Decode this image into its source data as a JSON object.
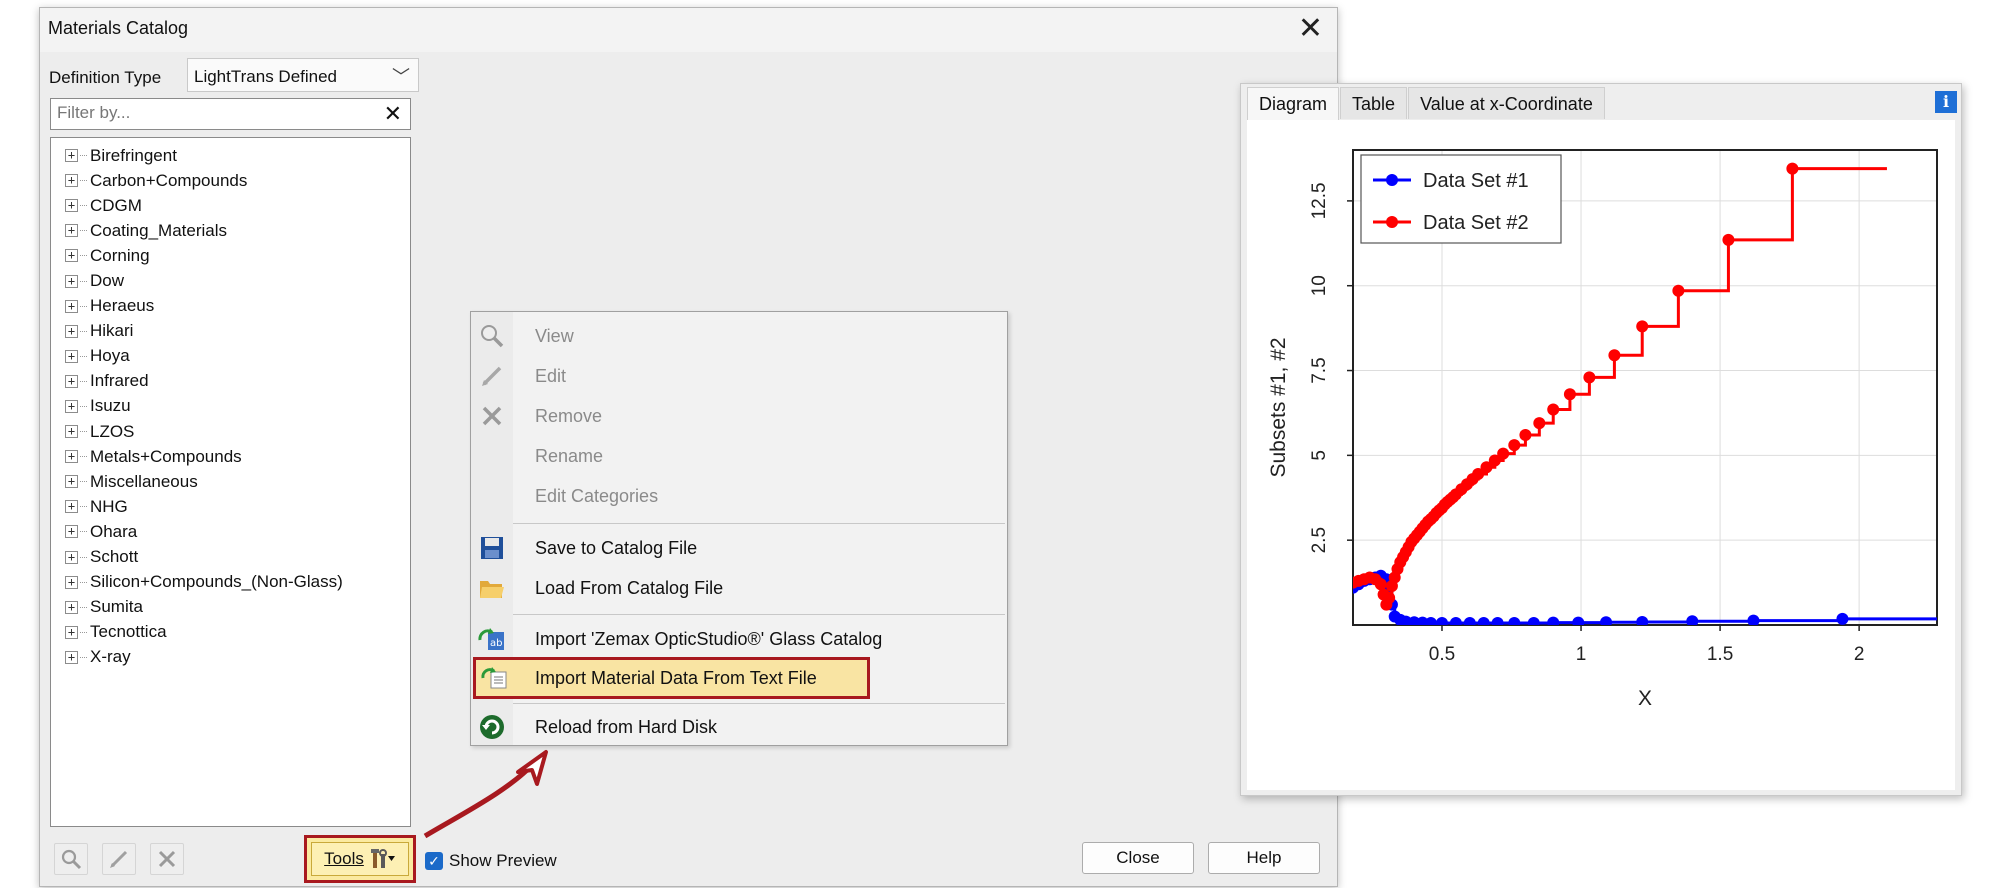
{
  "dialog": {
    "title": "Materials Catalog",
    "definition_type_label": "Definition Type",
    "definition_type_value": "LightTrans Defined",
    "filter_placeholder": "Filter by...",
    "tree_items": [
      "Birefringent",
      "Carbon+Compounds",
      "CDGM",
      "Coating_Materials",
      "Corning",
      "Dow",
      "Heraeus",
      "Hikari",
      "Hoya",
      "Infrared",
      "Isuzu",
      "LZOS",
      "Metals+Compounds",
      "Miscellaneous",
      "NHG",
      "Ohara",
      "Schott",
      "Silicon+Compounds_(Non-Glass)",
      "Sumita",
      "Tecnottica",
      "X-ray"
    ],
    "tools_label": "Tools",
    "show_preview_label": "Show Preview",
    "close_label": "Close",
    "help_label": "Help"
  },
  "menu": {
    "items": [
      {
        "label": "View",
        "icon": "magnifier-icon",
        "enabled": false
      },
      {
        "label": "Edit",
        "icon": "pencil-icon",
        "enabled": false
      },
      {
        "label": "Remove",
        "icon": "x-icon",
        "enabled": false
      },
      {
        "label": "Rename",
        "icon": "",
        "enabled": false
      },
      {
        "label": "Edit Categories",
        "icon": "",
        "enabled": false
      },
      {
        "label": "Save to Catalog File",
        "icon": "floppy-icon",
        "enabled": true
      },
      {
        "label": "Load From Catalog File",
        "icon": "folder-icon",
        "enabled": true
      },
      {
        "label": "Import 'Zemax OpticStudio®' Glass Catalog",
        "icon": "import-glass-icon",
        "enabled": true
      },
      {
        "label": "Import Material Data From Text File",
        "icon": "import-text-icon",
        "enabled": true
      },
      {
        "label": "Reload from Hard Disk",
        "icon": "reload-icon",
        "enabled": true
      }
    ]
  },
  "diagram": {
    "tabs": [
      "Diagram",
      "Table",
      "Value at x-Coordinate"
    ],
    "active_tab": "Diagram"
  },
  "colors": {
    "highlight_border": "#a8191f",
    "highlight_fill": "#f9e4a3",
    "series1": "#0000ff",
    "series2": "#ff0000"
  },
  "chart_data": {
    "type": "line",
    "xlabel": "X",
    "ylabel": "Subsets #1, #2",
    "xlim": [
      0.18,
      2.28
    ],
    "ylim": [
      0,
      14
    ],
    "xticks": [
      0.5,
      1,
      1.5,
      2
    ],
    "yticks": [
      2.5,
      5,
      7.5,
      10,
      12.5
    ],
    "xtick_labels": [
      "0.5",
      "1",
      "1.5",
      "2"
    ],
    "ytick_labels": [
      "2.5",
      "5",
      "7.5",
      "10",
      "12.5"
    ],
    "grid": true,
    "legend": "top-left",
    "series": [
      {
        "name": "Data Set #1",
        "color": "#0000ff",
        "x": [
          0.18,
          0.2,
          0.22,
          0.24,
          0.26,
          0.28,
          0.3,
          0.31,
          0.32,
          0.33,
          0.35,
          0.37,
          0.4,
          0.43,
          0.46,
          0.5,
          0.55,
          0.6,
          0.65,
          0.7,
          0.76,
          0.83,
          0.9,
          0.99,
          1.09,
          1.22,
          1.4,
          1.62,
          1.94,
          2.28
        ],
        "y": [
          1.1,
          1.2,
          1.3,
          1.35,
          1.4,
          1.45,
          1.35,
          1.1,
          0.6,
          0.25,
          0.15,
          0.1,
          0.08,
          0.07,
          0.06,
          0.06,
          0.06,
          0.06,
          0.06,
          0.06,
          0.06,
          0.06,
          0.07,
          0.07,
          0.08,
          0.09,
          0.11,
          0.13,
          0.18,
          0.18
        ]
      },
      {
        "name": "Data Set #2",
        "color": "#ff0000",
        "x": [
          0.18,
          0.2,
          0.22,
          0.24,
          0.26,
          0.28,
          0.29,
          0.3,
          0.31,
          0.32,
          0.33,
          0.34,
          0.35,
          0.36,
          0.37,
          0.38,
          0.39,
          0.4,
          0.41,
          0.42,
          0.43,
          0.44,
          0.45,
          0.46,
          0.47,
          0.48,
          0.49,
          0.5,
          0.51,
          0.52,
          0.53,
          0.54,
          0.55,
          0.57,
          0.59,
          0.61,
          0.63,
          0.66,
          0.69,
          0.72,
          0.76,
          0.8,
          0.85,
          0.9,
          0.96,
          1.03,
          1.12,
          1.22,
          1.35,
          1.53,
          1.76,
          2.1
        ],
        "y": [
          1.25,
          1.3,
          1.35,
          1.4,
          1.35,
          1.2,
          0.9,
          0.6,
          0.8,
          1.15,
          1.4,
          1.65,
          1.85,
          2.0,
          2.15,
          2.3,
          2.45,
          2.55,
          2.65,
          2.75,
          2.85,
          2.95,
          3.05,
          3.12,
          3.2,
          3.3,
          3.38,
          3.45,
          3.55,
          3.63,
          3.7,
          3.77,
          3.85,
          4.0,
          4.15,
          4.3,
          4.45,
          4.65,
          4.85,
          5.05,
          5.3,
          5.6,
          5.95,
          6.35,
          6.8,
          7.3,
          7.95,
          8.8,
          9.85,
          11.35,
          13.45,
          13.45
        ]
      }
    ]
  }
}
